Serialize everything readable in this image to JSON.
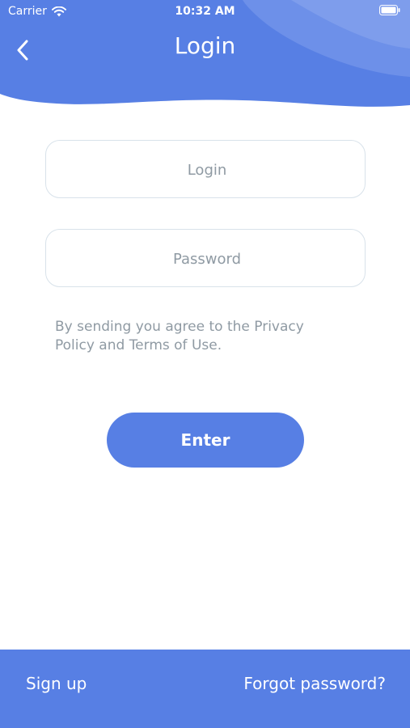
{
  "status_bar": {
    "carrier": "Carrier",
    "time": "10:32 AM"
  },
  "header": {
    "title": "Login",
    "back_icon": "chevron-left-icon"
  },
  "form": {
    "login_placeholder": "Login",
    "login_value": "",
    "password_placeholder": "Password",
    "password_value": "",
    "consent_text": "By sending you agree to the Privacy Policy and Terms of Use.",
    "enter_label": "Enter"
  },
  "footer": {
    "sign_up_label": "Sign up",
    "forgot_label": "Forgot password?"
  },
  "colors": {
    "accent": "#577fe4",
    "header_light": "#8aa6f0",
    "field_border": "#d8e2ea",
    "muted_text": "#8f9aa3"
  }
}
